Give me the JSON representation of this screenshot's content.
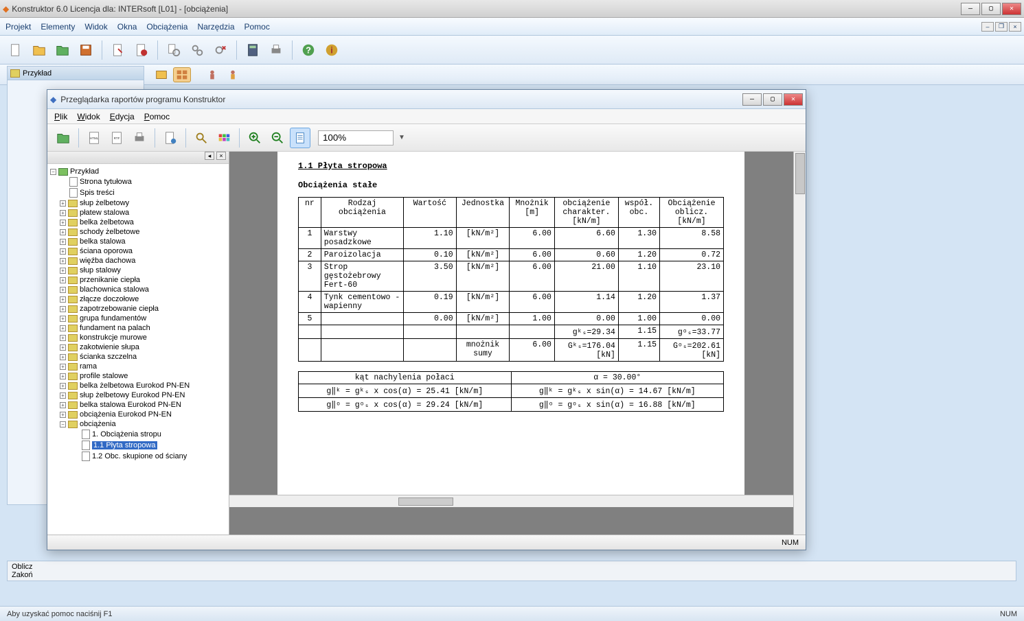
{
  "main_title": "Konstruktor 6.0 Licencja dla: INTERsoft [L01] - [obciążenia]",
  "main_menu": [
    "Projekt",
    "Elementy",
    "Widok",
    "Okna",
    "Obciążenia",
    "Narzędzia",
    "Pomoc"
  ],
  "left_dock": {
    "root": "Przykład"
  },
  "bottom_panel": {
    "line1": "Oblicz",
    "line2": "Zakoń"
  },
  "statusbar": {
    "hint": "Aby uzyskać pomoc naciśnij F1",
    "num": "NUM"
  },
  "report_window": {
    "title": "Przeglądarka raportów programu Konstruktor",
    "menu": [
      "Plik",
      "Widok",
      "Edycja",
      "Pomoc"
    ],
    "zoom": "100%",
    "status_num": "NUM",
    "tree": {
      "root": "Przykład",
      "items_lvl1": [
        "Strona tytułowa",
        "Spis treści"
      ],
      "items_lvl1_expandable": [
        "słup żelbetowy",
        "płatew stalowa",
        "belka żelbetowa",
        "schody żelbetowe",
        "belka stalowa",
        "ściana oporowa",
        "więźba dachowa",
        "słup stalowy",
        "przenikanie ciepła",
        "blachownica stalowa",
        "złącze doczołowe",
        "zapotrzebowanie ciepła",
        "grupa fundamentów",
        "fundament na palach",
        "konstrukcje murowe",
        "zakotwienie słupa",
        "ścianka szczelna",
        "rama",
        "profile stalowe",
        "belka żelbetowa Eurokod PN-EN",
        "słup żelbetowy Eurokod PN-EN",
        "belka stalowa Eurokod PN-EN",
        "obciążenia Eurokod PN-EN"
      ],
      "obciazenia_label": "obciążenia",
      "obciazenia_children": [
        "1. Obciążenia stropu",
        "1.1 Płyta stropowa",
        "1.2 Obc. skupione od ściany"
      ],
      "selected": "1.1 Płyta stropowa"
    }
  },
  "report_content": {
    "section_title": "1.1 Płyta stropowa",
    "subsection": "Obciążenia stałe",
    "headers": {
      "nr": "nr",
      "rodzaj": "Rodzaj obciążenia",
      "wartosc": "Wartość",
      "jednostka": "Jednostka",
      "mnoznik": "Mnożnik [m]",
      "charakter": "obciążenie charakter. [kN/m]",
      "wspol": "współ. obc.",
      "oblicz": "Obciążenie oblicz. [kN/m]"
    },
    "rows": [
      {
        "nr": "1",
        "rodzaj": "Warstwy posadzkowe",
        "wartosc": "1.10",
        "jednostka": "[kN/m²]",
        "mnoznik": "6.00",
        "charakter": "6.60",
        "wspol": "1.30",
        "oblicz": "8.58"
      },
      {
        "nr": "2",
        "rodzaj": "Paroizolacja",
        "wartosc": "0.10",
        "jednostka": "[kN/m²]",
        "mnoznik": "6.00",
        "charakter": "0.60",
        "wspol": "1.20",
        "oblicz": "0.72"
      },
      {
        "nr": "3",
        "rodzaj": "Strop gęstożebrowy Fert-60",
        "wartosc": "3.50",
        "jednostka": "[kN/m²]",
        "mnoznik": "6.00",
        "charakter": "21.00",
        "wspol": "1.10",
        "oblicz": "23.10"
      },
      {
        "nr": "4",
        "rodzaj": "Tynk cementowo - wapienny",
        "wartosc": "0.19",
        "jednostka": "[kN/m²]",
        "mnoznik": "6.00",
        "charakter": "1.14",
        "wspol": "1.20",
        "oblicz": "1.37"
      },
      {
        "nr": "5",
        "rodzaj": "",
        "wartosc": "0.00",
        "jednostka": "[kN/m²]",
        "mnoznik": "1.00",
        "charakter": "0.00",
        "wspol": "1.00",
        "oblicz": "0.00"
      }
    ],
    "sum_row1": {
      "charakter": "gᵏₛ=29.34",
      "wspol": "1.15",
      "oblicz": "gᵒₛ=33.77"
    },
    "sum_row2": {
      "label": "mnożnik sumy",
      "mnoznik": "6.00",
      "charakter": "Gᵏₛ=176.04 [kN]",
      "wspol": "1.15",
      "oblicz": "Gᵒₛ=202.61 [kN]"
    },
    "angle_table": {
      "header_left": "kąt nachylenia połaci",
      "header_right": "α = 30.00°",
      "r1l": "g‖ᵏ = gᵏₛ x cos(α) = 25.41 [kN/m]",
      "r1r": "g‖ᵏ = gᵏₛ x sin(α) = 14.67 [kN/m]",
      "r2l": "g‖ᵒ = gᵒₛ x cos(α) = 29.24 [kN/m]",
      "r2r": "g‖ᵒ = gᵒₛ x sin(α) = 16.88 [kN/m]"
    }
  }
}
